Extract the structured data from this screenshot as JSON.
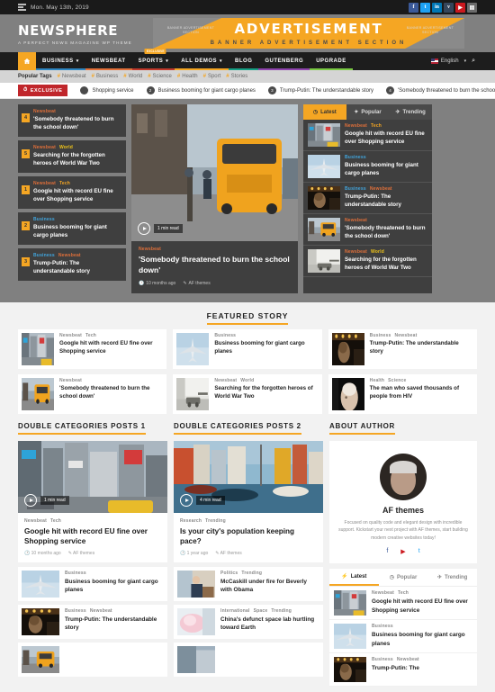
{
  "topbar": {
    "date": "Mon. May 13th, 2019",
    "menu_icon": "hamburger-icon",
    "social": [
      {
        "name": "facebook",
        "glyph": "f"
      },
      {
        "name": "twitter",
        "glyph": "t"
      },
      {
        "name": "linkedin",
        "glyph": "in"
      },
      {
        "name": "vimeo",
        "glyph": "v"
      },
      {
        "name": "youtube",
        "glyph": "▶"
      },
      {
        "name": "rss",
        "glyph": "▤"
      }
    ]
  },
  "header": {
    "logo": "NEWSPHERE",
    "tagline": "A PERFECT NEWS MAGAZINE WP THEME",
    "ad": {
      "main": "ADVERTISEMENT",
      "sub": "BANNER ADVERTISEMENT SECTION",
      "tag_left": "BANNER ADVERTISEMENT SECTION",
      "tag_right": "BANNER ADVERTISEMENT SECTION",
      "color": "#f5a623"
    }
  },
  "nav": {
    "home_icon": "home-icon",
    "items": [
      {
        "label": "BUSINESS",
        "caret": true,
        "bar": "#2e86c1",
        "badge": ""
      },
      {
        "label": "NEWSBEAT",
        "caret": false,
        "bar": "#e2703a",
        "badge": ""
      },
      {
        "label": "SPORTS",
        "caret": true,
        "bar": "#c0392b",
        "badge": "EXCLUSIVE"
      },
      {
        "label": "ALL DEMOS",
        "caret": true,
        "bar": "#f5a623",
        "badge": ""
      },
      {
        "label": "BLOG",
        "caret": false,
        "bar": "#16a085",
        "badge": ""
      },
      {
        "label": "GUTENBERG",
        "caret": false,
        "bar": "#8e44ad",
        "badge": ""
      },
      {
        "label": "UPGRADE",
        "caret": false,
        "bar": "#7ac943",
        "badge": ""
      }
    ],
    "language": "English",
    "search_icon": "search-icon"
  },
  "tags": {
    "label": "Popular Tags",
    "items": [
      "Newsbeat",
      "Business",
      "World",
      "Science",
      "Health",
      "Sport",
      "Stories"
    ]
  },
  "ticker": {
    "badge": "EXCLUSIVE",
    "items": [
      {
        "num": "",
        "text": "Shopping service"
      },
      {
        "num": "2",
        "text": "Business booming for giant cargo planes"
      },
      {
        "num": "3",
        "text": "Trump-Putin: The understandable story"
      },
      {
        "num": "4",
        "text": "'Somebody threatened to burn the school d"
      }
    ]
  },
  "hero": {
    "left_list": [
      {
        "num": "4",
        "cats": [
          {
            "t": "Newsbeat",
            "c": "newsbeat"
          }
        ],
        "title": "'Somebody threatened to burn the school down'"
      },
      {
        "num": "5",
        "cats": [
          {
            "t": "Newsbeat",
            "c": "newsbeat"
          },
          {
            "t": "World",
            "c": "world"
          }
        ],
        "title": "Searching for the forgotten heroes of World War Two"
      },
      {
        "num": "1",
        "cats": [
          {
            "t": "Newsbeat",
            "c": "newsbeat"
          },
          {
            "t": "Tech",
            "c": "tech"
          }
        ],
        "title": "Google hit with record EU fine over Shopping service"
      },
      {
        "num": "2",
        "cats": [
          {
            "t": "Business",
            "c": "business"
          }
        ],
        "title": "Business booming for giant cargo planes"
      },
      {
        "num": "3",
        "cats": [
          {
            "t": "Business",
            "c": "business"
          },
          {
            "t": "Newsbeat",
            "c": "newsbeat"
          }
        ],
        "title": "Trump-Putin: The understandable story"
      }
    ],
    "main": {
      "read_time": "1 min read",
      "cats": [
        {
          "t": "Newsbeat",
          "c": "newsbeat"
        }
      ],
      "title": "'Somebody threatened to burn the school down'",
      "date": "10 months ago",
      "author": "AF themes",
      "play_icon": "play-icon"
    },
    "tabs": [
      {
        "label": "Latest",
        "icon": "clock-icon",
        "active": true
      },
      {
        "label": "Popular",
        "icon": "fire-icon",
        "active": false
      },
      {
        "label": "Trending",
        "icon": "trend-icon",
        "active": false
      }
    ],
    "right_list": [
      {
        "cats": [
          {
            "t": "Newsbeat",
            "c": "newsbeat"
          },
          {
            "t": "Tech",
            "c": "tech"
          }
        ],
        "title": "Google hit with record EU fine over Shopping service",
        "img": "city"
      },
      {
        "cats": [
          {
            "t": "Business",
            "c": "business"
          }
        ],
        "title": "Business booming for giant cargo planes",
        "img": "plane"
      },
      {
        "cats": [
          {
            "t": "Business",
            "c": "business"
          },
          {
            "t": "Newsbeat",
            "c": "newsbeat"
          }
        ],
        "title": "Trump-Putin: The understandable story",
        "img": "dark"
      },
      {
        "cats": [
          {
            "t": "Newsbeat",
            "c": "newsbeat"
          }
        ],
        "title": "'Somebody threatened to burn the school down'",
        "img": "bus"
      },
      {
        "cats": [
          {
            "t": "Newsbeat",
            "c": "newsbeat"
          },
          {
            "t": "World",
            "c": "world"
          }
        ],
        "title": "Searching for the forgotten heroes of World War Two",
        "img": "ww2"
      }
    ]
  },
  "featured": {
    "title": "FEATURED STORY",
    "cards": [
      {
        "cats": [
          {
            "t": "Newsbeat",
            "c": "newsbeat"
          },
          {
            "t": "Tech",
            "c": "tech"
          }
        ],
        "title": "Google hit with record EU fine over Shopping service",
        "img": "city"
      },
      {
        "cats": [
          {
            "t": "Business",
            "c": "business"
          }
        ],
        "title": "Business booming for giant cargo planes",
        "img": "plane"
      },
      {
        "cats": [
          {
            "t": "Business",
            "c": "business"
          },
          {
            "t": "Newsbeat",
            "c": "newsbeat"
          }
        ],
        "title": "Trump-Putin: The understandable story",
        "img": "dark"
      },
      {
        "cats": [
          {
            "t": "Newsbeat",
            "c": "newsbeat"
          }
        ],
        "title": "'Somebody threatened to burn the school down'",
        "img": "bus"
      },
      {
        "cats": [
          {
            "t": "Newsbeat",
            "c": "newsbeat"
          },
          {
            "t": "World",
            "c": "world"
          }
        ],
        "title": "Searching for the forgotten heroes of World War Two",
        "img": "ww2"
      },
      {
        "cats": [
          {
            "t": "Health",
            "c": "health"
          },
          {
            "t": "Science",
            "c": "science"
          }
        ],
        "title": "The man who saved thousands of people from HIV",
        "img": "hiv"
      }
    ]
  },
  "double1": {
    "title": "DOUBLE CATEGORIES POSTS 1",
    "big": {
      "read_time": "1 min read",
      "cats": [
        {
          "t": "Newsbeat",
          "c": "newsbeat"
        },
        {
          "t": "Tech",
          "c": "tech"
        }
      ],
      "title": "Google hit with record EU fine over Shopping service",
      "date": "10 months ago",
      "author": "AF themes",
      "img": "city"
    },
    "items": [
      {
        "cats": [
          {
            "t": "Business",
            "c": "business"
          }
        ],
        "title": "Business booming for giant cargo planes",
        "img": "plane"
      },
      {
        "cats": [
          {
            "t": "Business",
            "c": "business"
          },
          {
            "t": "Newsbeat",
            "c": "newsbeat"
          }
        ],
        "title": "Trump-Putin: The understandable story",
        "img": "dark"
      },
      {
        "cats": [],
        "title": "",
        "img": "bus"
      }
    ]
  },
  "double2": {
    "title": "DOUBLE CATEGORIES POSTS 2",
    "big": {
      "read_time": "4 min read",
      "cats": [
        {
          "t": "Research",
          "c": "research"
        },
        {
          "t": "Trending",
          "c": "trending"
        }
      ],
      "title": "Is your city's population keeping pace?",
      "date": "1 year ago",
      "author": "AF themes",
      "img": "harbor"
    },
    "items": [
      {
        "cats": [
          {
            "t": "Politics",
            "c": "politics"
          },
          {
            "t": "Trending",
            "c": "trending"
          }
        ],
        "title": "McCaskill under fire for Beverly with Obama",
        "img": "office"
      },
      {
        "cats": [
          {
            "t": "International",
            "c": "international"
          },
          {
            "t": "Space",
            "c": "space"
          },
          {
            "t": "Trending",
            "c": "trending"
          }
        ],
        "title": "China's defunct space lab hurtling toward Earth",
        "img": "space"
      },
      {
        "cats": [],
        "title": "",
        "img": "misc"
      }
    ]
  },
  "sidebar": {
    "about_title": "ABOUT AUTHOR",
    "author_name": "AF themes",
    "author_desc": "Focused on quality code and elegant design with incredible support. Kickstart your next project with AF themes, start building modern creative websites today!",
    "author_social": [
      {
        "name": "facebook",
        "glyph": "f"
      },
      {
        "name": "youtube",
        "glyph": "▶"
      },
      {
        "name": "twitter",
        "glyph": "t"
      }
    ],
    "tabs": [
      {
        "label": "Latest",
        "icon": "bolt-icon",
        "active": true
      },
      {
        "label": "Popular",
        "icon": "clock-icon",
        "active": false
      },
      {
        "label": "Trending",
        "icon": "trend-icon",
        "active": false
      }
    ],
    "items": [
      {
        "cats": [
          {
            "t": "Newsbeat",
            "c": "newsbeat"
          },
          {
            "t": "Tech",
            "c": "tech"
          }
        ],
        "title": "Google hit with record EU fine over Shopping service",
        "img": "city"
      },
      {
        "cats": [
          {
            "t": "Business",
            "c": "business"
          }
        ],
        "title": "Business booming for giant cargo planes",
        "img": "plane"
      },
      {
        "cats": [
          {
            "t": "Business",
            "c": "business"
          },
          {
            "t": "Newsbeat",
            "c": "newsbeat"
          }
        ],
        "title": "Trump-Putin: The",
        "img": "dark"
      }
    ]
  }
}
